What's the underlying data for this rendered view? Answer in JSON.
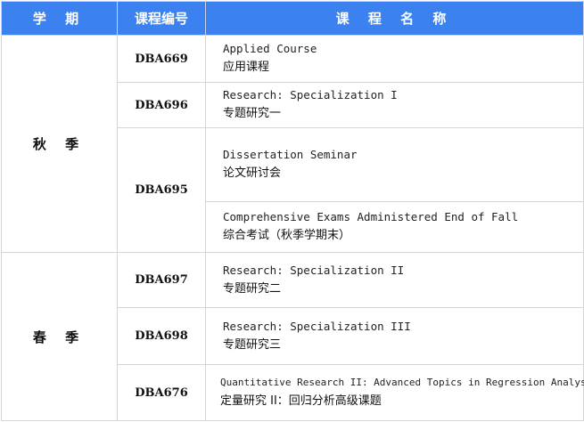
{
  "header": {
    "semester": "学 期",
    "code": "课程编号",
    "name": "课 程 名 称"
  },
  "terms": [
    {
      "name": "秋 季",
      "rows": [
        {
          "code": "DBA669",
          "courses": [
            {
              "en": "Applied Course",
              "zh": "应用课程"
            }
          ]
        },
        {
          "code": "DBA696",
          "courses": [
            {
              "en": "Research: Specialization I",
              "zh": "专题研究一"
            }
          ]
        },
        {
          "code": "DBA695",
          "courses": [
            {
              "en": "Dissertation Seminar",
              "zh": "论文研讨会"
            },
            {
              "en": "Comprehensive Exams Administered End of Fall",
              "zh": "综合考试（秋季学期末）"
            }
          ]
        }
      ]
    },
    {
      "name": "春 季",
      "rows": [
        {
          "code": "DBA697",
          "courses": [
            {
              "en": "Research: Specialization II",
              "zh": "专题研究二"
            }
          ]
        },
        {
          "code": "DBA698",
          "courses": [
            {
              "en": "Research: Specialization III",
              "zh": "专题研究三"
            }
          ]
        },
        {
          "code": "DBA676",
          "courses": [
            {
              "en": "Quantitative Research II: Advanced Topics in Regression Analysis",
              "zh": "定量研究 II：回归分析高级课题"
            }
          ]
        }
      ]
    }
  ]
}
